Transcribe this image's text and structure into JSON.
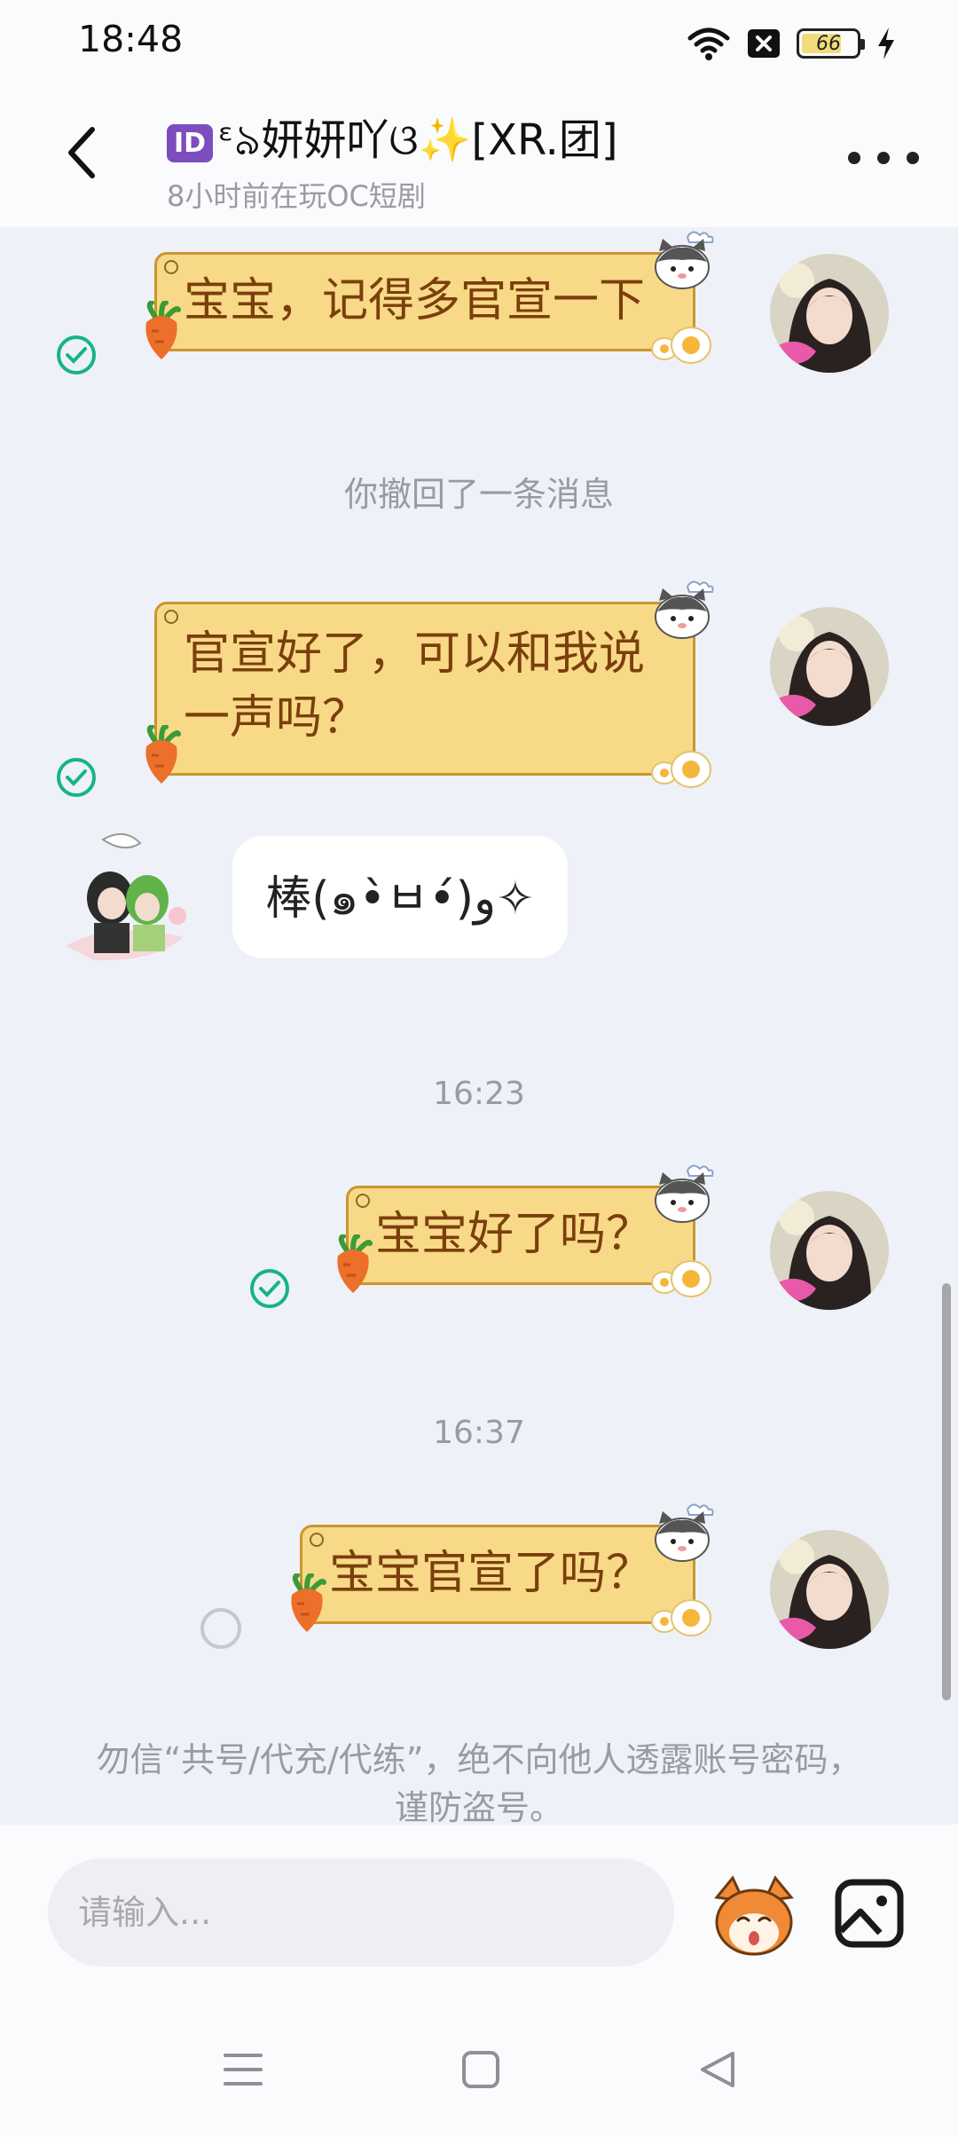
{
  "status_bar": {
    "time": "18:48",
    "battery_level": "66"
  },
  "header": {
    "title": "ᵋ৯妍妍吖ଓ✨[XR.团]",
    "id_badge": "ID",
    "subtitle": "8小时前在玩OC短剧"
  },
  "messages": [
    {
      "side": "right",
      "text": "宝宝，记得多官宣一下",
      "status": "read"
    },
    {
      "type": "system",
      "text": "你撤回了一条消息"
    },
    {
      "side": "right",
      "text": "官宣好了，可以和我说一声吗？",
      "status": "read"
    },
    {
      "side": "left",
      "text": "棒(๑•̀ㅂ•́)و✧"
    },
    {
      "type": "time",
      "text": "16:23"
    },
    {
      "side": "right",
      "text": "宝宝好了吗？",
      "status": "read"
    },
    {
      "type": "time",
      "text": "16:37"
    },
    {
      "side": "right",
      "text": "宝宝官宣了吗？",
      "status": "sending"
    }
  ],
  "notice": "勿信“共号/代充/代练”，绝不向他人透露账号密码，谨防盗号。",
  "input": {
    "placeholder": "请输入..."
  },
  "icons": {
    "back": "chevron-left-icon",
    "more": "more-dots-icon",
    "emoji": "fox-emoji-icon",
    "image": "image-icon",
    "nav_menu": "menu-icon",
    "nav_home": "square-home-icon",
    "nav_back": "triangle-back-icon"
  },
  "colors": {
    "bubble_yellow": "#f8d987",
    "bubble_text": "#7a3f0c",
    "check_green": "#16b38a",
    "chat_bg": "#eff1f8"
  }
}
